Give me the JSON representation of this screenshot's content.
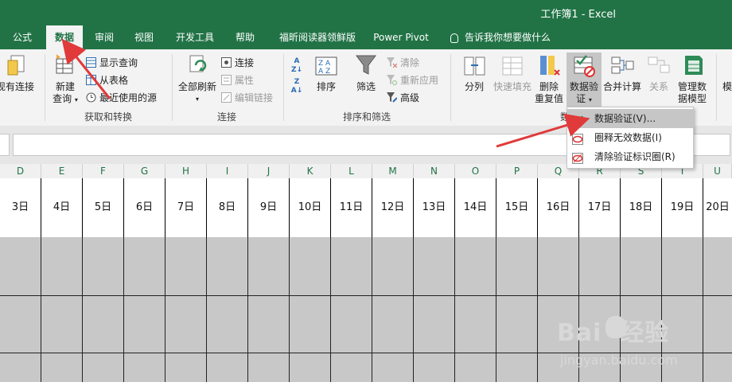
{
  "window": {
    "title": "工作簿1 - Excel"
  },
  "tabs": [
    {
      "label": "公式"
    },
    {
      "label": "数据",
      "active": true
    },
    {
      "label": "审阅"
    },
    {
      "label": "视图"
    },
    {
      "label": "开发工具"
    },
    {
      "label": "帮助"
    },
    {
      "label": "福昕阅读器领鲜版"
    },
    {
      "label": "Power Pivot"
    }
  ],
  "tell_me": "告诉我你想要做什么",
  "ribbon": {
    "existing_connections": "现有连接",
    "get_transform": {
      "group_label": "获取和转换",
      "new_query_l1": "新建",
      "new_query_l2": "查询",
      "show_queries": "显示查询",
      "from_table": "从表格",
      "recent_sources": "最近使用的源"
    },
    "connections": {
      "group_label": "连接",
      "refresh_all": "全部刷新",
      "connections": "连接",
      "properties": "属性",
      "edit_links": "编辑链接"
    },
    "sort_filter": {
      "group_label": "排序和筛选",
      "sort": "排序",
      "filter": "筛选",
      "clear": "清除",
      "reapply": "重新应用",
      "advanced": "高级"
    },
    "data_tools": {
      "group_label_partial": "数",
      "text_to_columns": "分列",
      "flash_fill": "快速填充",
      "remove_dup_l1": "删除",
      "remove_dup_l2": "重复值",
      "validation_l1": "数据验",
      "validation_l2": "证",
      "consolidate": "合并计算",
      "relationships": "关系",
      "manage_model_l1": "管理数",
      "manage_model_l2": "据模型",
      "forecast_partial": "模"
    }
  },
  "validation_menu": [
    {
      "label": "数据验证(V)...",
      "selected": true
    },
    {
      "label": "圈释无效数据(I)"
    },
    {
      "label": "清除验证标识圈(R)"
    }
  ],
  "columns": [
    "D",
    "E",
    "F",
    "G",
    "H",
    "I",
    "J",
    "K",
    "L",
    "M",
    "N",
    "O",
    "P",
    "Q",
    "R",
    "S",
    "T",
    "U"
  ],
  "dates": [
    "3日",
    "4日",
    "5日",
    "6日",
    "7日",
    "8日",
    "9日",
    "10日",
    "11日",
    "12日",
    "13日",
    "14日",
    "15日",
    "16日",
    "17日",
    "18日",
    "19日",
    "20日"
  ],
  "watermark": {
    "brand": "Bai  经验",
    "url": "jingyan.baidu.com"
  },
  "colors": {
    "excel_green": "#217346",
    "arrow_red": "#e03a3a",
    "highlight": "#c6c6c6",
    "sheet_gray": "#c8c8c8"
  }
}
